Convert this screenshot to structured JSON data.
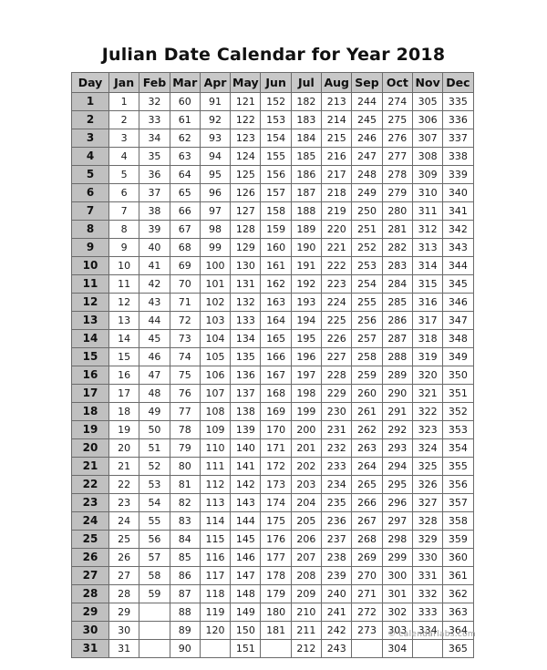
{
  "page": {
    "title": "Julian Date Calendar for Year 2018",
    "year": "2018",
    "background_color": "#ffffff",
    "header_fill": "#c8c8c8",
    "day_column_fill": "#c0c0c0",
    "border_color": "#6b6b6b"
  },
  "table": {
    "day_header": "Day",
    "month_headers": [
      "Jan",
      "Feb",
      "Mar",
      "Apr",
      "May",
      "Jun",
      "Jul",
      "Aug",
      "Sep",
      "Oct",
      "Nov",
      "Dec"
    ],
    "rows": [
      {
        "day": "1",
        "values": [
          "1",
          "32",
          "60",
          "91",
          "121",
          "152",
          "182",
          "213",
          "244",
          "274",
          "305",
          "335"
        ]
      },
      {
        "day": "2",
        "values": [
          "2",
          "33",
          "61",
          "92",
          "122",
          "153",
          "183",
          "214",
          "245",
          "275",
          "306",
          "336"
        ]
      },
      {
        "day": "3",
        "values": [
          "3",
          "34",
          "62",
          "93",
          "123",
          "154",
          "184",
          "215",
          "246",
          "276",
          "307",
          "337"
        ]
      },
      {
        "day": "4",
        "values": [
          "4",
          "35",
          "63",
          "94",
          "124",
          "155",
          "185",
          "216",
          "247",
          "277",
          "308",
          "338"
        ]
      },
      {
        "day": "5",
        "values": [
          "5",
          "36",
          "64",
          "95",
          "125",
          "156",
          "186",
          "217",
          "248",
          "278",
          "309",
          "339"
        ]
      },
      {
        "day": "6",
        "values": [
          "6",
          "37",
          "65",
          "96",
          "126",
          "157",
          "187",
          "218",
          "249",
          "279",
          "310",
          "340"
        ]
      },
      {
        "day": "7",
        "values": [
          "7",
          "38",
          "66",
          "97",
          "127",
          "158",
          "188",
          "219",
          "250",
          "280",
          "311",
          "341"
        ]
      },
      {
        "day": "8",
        "values": [
          "8",
          "39",
          "67",
          "98",
          "128",
          "159",
          "189",
          "220",
          "251",
          "281",
          "312",
          "342"
        ]
      },
      {
        "day": "9",
        "values": [
          "9",
          "40",
          "68",
          "99",
          "129",
          "160",
          "190",
          "221",
          "252",
          "282",
          "313",
          "343"
        ]
      },
      {
        "day": "10",
        "values": [
          "10",
          "41",
          "69",
          "100",
          "130",
          "161",
          "191",
          "222",
          "253",
          "283",
          "314",
          "344"
        ]
      },
      {
        "day": "11",
        "values": [
          "11",
          "42",
          "70",
          "101",
          "131",
          "162",
          "192",
          "223",
          "254",
          "284",
          "315",
          "345"
        ]
      },
      {
        "day": "12",
        "values": [
          "12",
          "43",
          "71",
          "102",
          "132",
          "163",
          "193",
          "224",
          "255",
          "285",
          "316",
          "346"
        ]
      },
      {
        "day": "13",
        "values": [
          "13",
          "44",
          "72",
          "103",
          "133",
          "164",
          "194",
          "225",
          "256",
          "286",
          "317",
          "347"
        ]
      },
      {
        "day": "14",
        "values": [
          "14",
          "45",
          "73",
          "104",
          "134",
          "165",
          "195",
          "226",
          "257",
          "287",
          "318",
          "348"
        ]
      },
      {
        "day": "15",
        "values": [
          "15",
          "46",
          "74",
          "105",
          "135",
          "166",
          "196",
          "227",
          "258",
          "288",
          "319",
          "349"
        ]
      },
      {
        "day": "16",
        "values": [
          "16",
          "47",
          "75",
          "106",
          "136",
          "167",
          "197",
          "228",
          "259",
          "289",
          "320",
          "350"
        ]
      },
      {
        "day": "17",
        "values": [
          "17",
          "48",
          "76",
          "107",
          "137",
          "168",
          "198",
          "229",
          "260",
          "290",
          "321",
          "351"
        ]
      },
      {
        "day": "18",
        "values": [
          "18",
          "49",
          "77",
          "108",
          "138",
          "169",
          "199",
          "230",
          "261",
          "291",
          "322",
          "352"
        ]
      },
      {
        "day": "19",
        "values": [
          "19",
          "50",
          "78",
          "109",
          "139",
          "170",
          "200",
          "231",
          "262",
          "292",
          "323",
          "353"
        ]
      },
      {
        "day": "20",
        "values": [
          "20",
          "51",
          "79",
          "110",
          "140",
          "171",
          "201",
          "232",
          "263",
          "293",
          "324",
          "354"
        ]
      },
      {
        "day": "21",
        "values": [
          "21",
          "52",
          "80",
          "111",
          "141",
          "172",
          "202",
          "233",
          "264",
          "294",
          "325",
          "355"
        ]
      },
      {
        "day": "22",
        "values": [
          "22",
          "53",
          "81",
          "112",
          "142",
          "173",
          "203",
          "234",
          "265",
          "295",
          "326",
          "356"
        ]
      },
      {
        "day": "23",
        "values": [
          "23",
          "54",
          "82",
          "113",
          "143",
          "174",
          "204",
          "235",
          "266",
          "296",
          "327",
          "357"
        ]
      },
      {
        "day": "24",
        "values": [
          "24",
          "55",
          "83",
          "114",
          "144",
          "175",
          "205",
          "236",
          "267",
          "297",
          "328",
          "358"
        ]
      },
      {
        "day": "25",
        "values": [
          "25",
          "56",
          "84",
          "115",
          "145",
          "176",
          "206",
          "237",
          "268",
          "298",
          "329",
          "359"
        ]
      },
      {
        "day": "26",
        "values": [
          "26",
          "57",
          "85",
          "116",
          "146",
          "177",
          "207",
          "238",
          "269",
          "299",
          "330",
          "360"
        ]
      },
      {
        "day": "27",
        "values": [
          "27",
          "58",
          "86",
          "117",
          "147",
          "178",
          "208",
          "239",
          "270",
          "300",
          "331",
          "361"
        ]
      },
      {
        "day": "28",
        "values": [
          "28",
          "59",
          "87",
          "118",
          "148",
          "179",
          "209",
          "240",
          "271",
          "301",
          "332",
          "362"
        ]
      },
      {
        "day": "29",
        "values": [
          "29",
          "",
          "88",
          "119",
          "149",
          "180",
          "210",
          "241",
          "272",
          "302",
          "333",
          "363"
        ]
      },
      {
        "day": "30",
        "values": [
          "30",
          "",
          "89",
          "120",
          "150",
          "181",
          "211",
          "242",
          "273",
          "303",
          "334",
          "364"
        ]
      },
      {
        "day": "31",
        "values": [
          "31",
          "",
          "90",
          "",
          "151",
          "",
          "212",
          "243",
          "",
          "304",
          "",
          "365"
        ]
      }
    ]
  },
  "footer": {
    "credit": "© calendarlabs.com"
  }
}
